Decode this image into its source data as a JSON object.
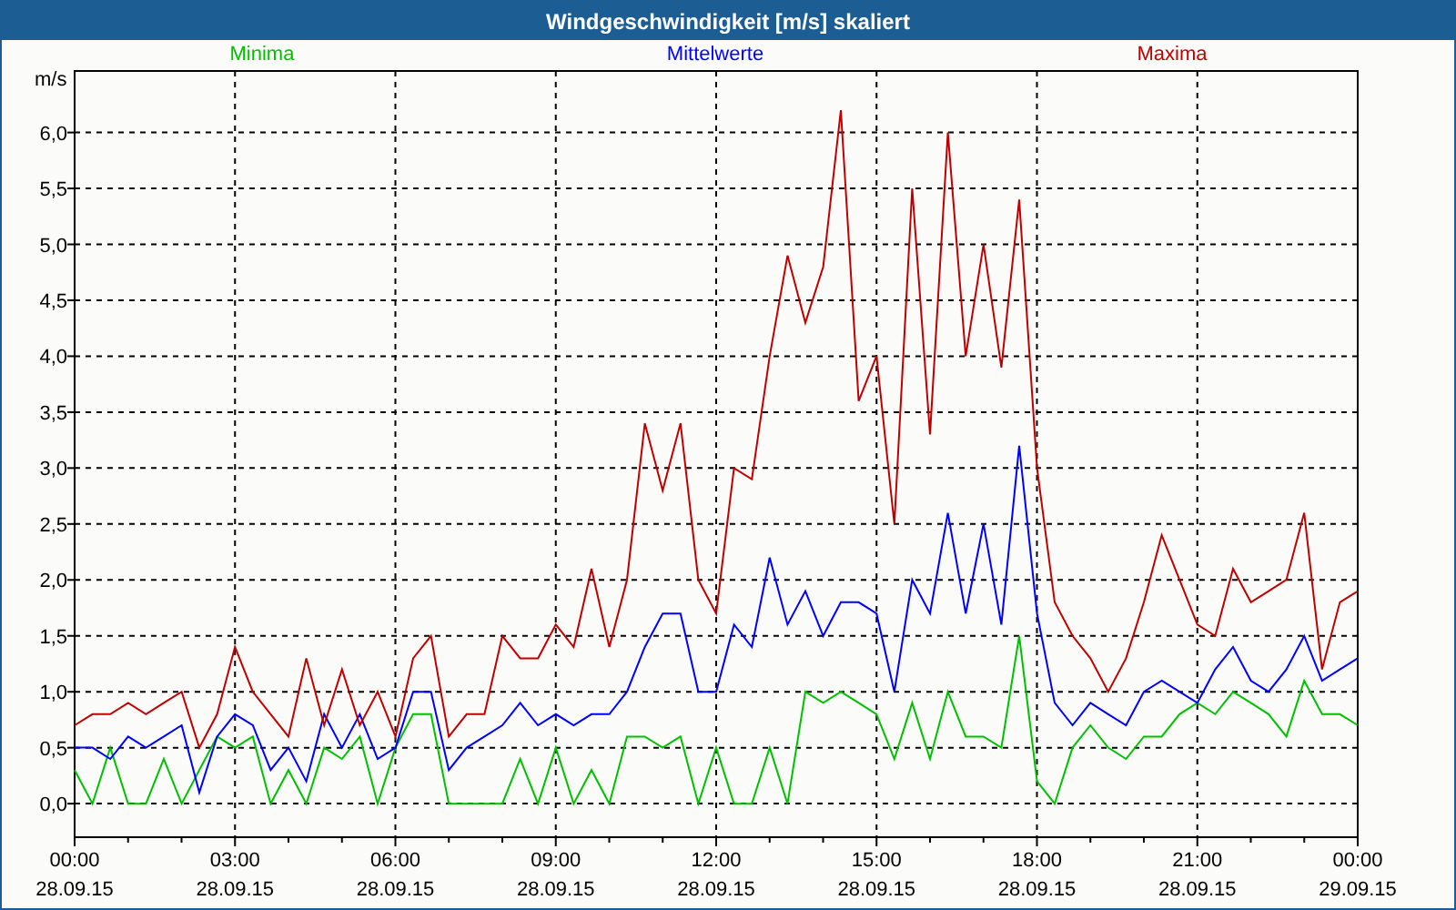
{
  "chart_data": {
    "type": "line",
    "title": "Windgeschwindigkeit [m/s] skaliert",
    "ylabel": "m/s",
    "categories": [
      "00:00 28.09.15",
      null,
      null,
      null,
      null,
      null,
      null,
      null,
      null,
      "03:00 28.09.15",
      null,
      null,
      null,
      null,
      null,
      null,
      null,
      null,
      "06:00 28.09.15",
      null,
      null,
      null,
      null,
      null,
      null,
      null,
      null,
      "09:00 28.09.15",
      null,
      null,
      null,
      null,
      null,
      null,
      null,
      null,
      "12:00 28.09.15",
      null,
      null,
      null,
      null,
      null,
      null,
      null,
      null,
      "15:00 28.09.15",
      null,
      null,
      null,
      null,
      null,
      null,
      null,
      null,
      "18:00 28.09.15",
      null,
      null,
      null,
      null,
      null,
      null,
      null,
      null,
      "21:00 28.09.15",
      null,
      null,
      null,
      null,
      null,
      null,
      null,
      null,
      "00:00 29.09.15"
    ],
    "series": [
      {
        "name": "Minima",
        "color": "#00c000",
        "values": [
          0.3,
          0.0,
          0.5,
          0.0,
          0.0,
          0.4,
          0.0,
          0.3,
          0.6,
          0.5,
          0.6,
          0.0,
          0.3,
          0.0,
          0.5,
          0.4,
          0.6,
          0.0,
          0.5,
          0.8,
          0.8,
          0.0,
          0.0,
          0.0,
          0.0,
          0.4,
          0.0,
          0.5,
          0.0,
          0.3,
          0.0,
          0.6,
          0.6,
          0.5,
          0.6,
          0.0,
          0.5,
          0.0,
          0.0,
          0.5,
          0.0,
          1.0,
          0.9,
          1.0,
          0.9,
          0.8,
          0.4,
          0.9,
          0.4,
          1.0,
          0.6,
          0.6,
          0.5,
          1.5,
          0.2,
          0.0,
          0.5,
          0.7,
          0.5,
          0.4,
          0.6,
          0.6,
          0.8,
          0.9,
          0.8,
          1.0,
          0.9,
          0.8,
          0.6,
          1.1,
          0.8,
          0.8,
          0.7
        ]
      },
      {
        "name": "Mittelwerte",
        "color": "#0000ff",
        "values": [
          0.5,
          0.5,
          0.4,
          0.6,
          0.5,
          0.6,
          0.7,
          0.1,
          0.6,
          0.8,
          0.7,
          0.3,
          0.5,
          0.2,
          0.8,
          0.5,
          0.8,
          0.4,
          0.5,
          1.0,
          1.0,
          0.3,
          0.5,
          0.6,
          0.7,
          0.9,
          0.7,
          0.8,
          0.7,
          0.8,
          0.8,
          1.0,
          1.4,
          1.7,
          1.7,
          1.0,
          1.0,
          1.6,
          1.4,
          2.2,
          1.6,
          1.9,
          1.5,
          1.8,
          1.8,
          1.7,
          1.0,
          2.0,
          1.7,
          2.6,
          1.7,
          2.5,
          1.6,
          3.2,
          1.7,
          0.9,
          0.7,
          0.9,
          0.8,
          0.7,
          1.0,
          1.1,
          1.0,
          0.9,
          1.2,
          1.4,
          1.1,
          1.0,
          1.2,
          1.5,
          1.1,
          1.2,
          1.3
        ]
      },
      {
        "name": "Maxima",
        "color": "#c00000",
        "values": [
          0.7,
          0.8,
          0.8,
          0.9,
          0.8,
          0.9,
          1.0,
          0.5,
          0.8,
          1.4,
          1.0,
          0.8,
          0.6,
          1.3,
          0.7,
          1.2,
          0.7,
          1.0,
          0.6,
          1.3,
          1.5,
          0.6,
          0.8,
          0.8,
          1.5,
          1.3,
          1.3,
          1.6,
          1.4,
          2.1,
          1.4,
          2.0,
          3.4,
          2.8,
          3.4,
          2.0,
          1.7,
          3.0,
          2.9,
          4.0,
          4.9,
          4.3,
          4.8,
          6.2,
          3.6,
          4.0,
          2.5,
          5.5,
          3.3,
          6.0,
          4.0,
          5.0,
          3.9,
          5.4,
          3.0,
          1.8,
          1.5,
          1.3,
          1.0,
          1.3,
          1.8,
          2.4,
          2.0,
          1.6,
          1.5,
          2.1,
          1.8,
          1.9,
          2.0,
          2.6,
          1.2,
          1.8,
          1.9
        ]
      }
    ],
    "ylim": [
      -0.3,
      6.55
    ],
    "grid": true,
    "yticks": [
      {
        "value": 0,
        "label": "0,0"
      },
      {
        "value": 0.5,
        "label": "0,5"
      },
      {
        "value": 1,
        "label": "1,0"
      },
      {
        "value": 1.5,
        "label": "1,5"
      },
      {
        "value": 2,
        "label": "2,0"
      },
      {
        "value": 2.5,
        "label": "2,5"
      },
      {
        "value": 3,
        "label": "3,0"
      },
      {
        "value": 3.5,
        "label": "3,5"
      },
      {
        "value": 4,
        "label": "4,0"
      },
      {
        "value": 4.5,
        "label": "4,5"
      },
      {
        "value": 5,
        "label": "5,0"
      },
      {
        "value": 5.5,
        "label": "5,5"
      },
      {
        "value": 6,
        "label": "6,0"
      }
    ]
  }
}
